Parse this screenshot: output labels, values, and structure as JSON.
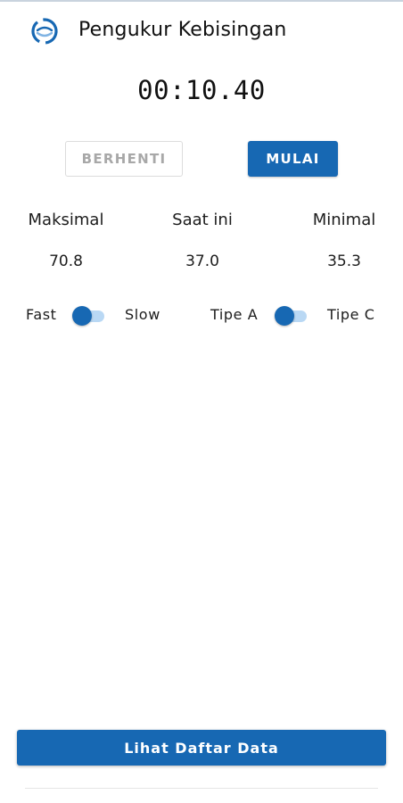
{
  "app": {
    "title": "Pengukur Kebisingan",
    "logo_icon": "app-logo-icon"
  },
  "timer": {
    "value": "00:10.40"
  },
  "controls": {
    "stop_label": "BERHENTI",
    "start_label": "MULAI"
  },
  "stats": {
    "max_label": "Maksimal",
    "max_value": "70.8",
    "current_label": "Saat ini",
    "current_value": "37.0",
    "min_label": "Minimal",
    "min_value": "35.3"
  },
  "toggles": {
    "response": {
      "left_label": "Fast",
      "right_label": "Slow",
      "selected": "Fast"
    },
    "weighting": {
      "left_label": "Tipe A",
      "right_label": "Tipe C",
      "selected": "Tipe A"
    }
  },
  "footer": {
    "list_button_label": "Lihat Daftar Data"
  },
  "colors": {
    "accent": "#1768b3",
    "track": "#b9d8f4"
  }
}
